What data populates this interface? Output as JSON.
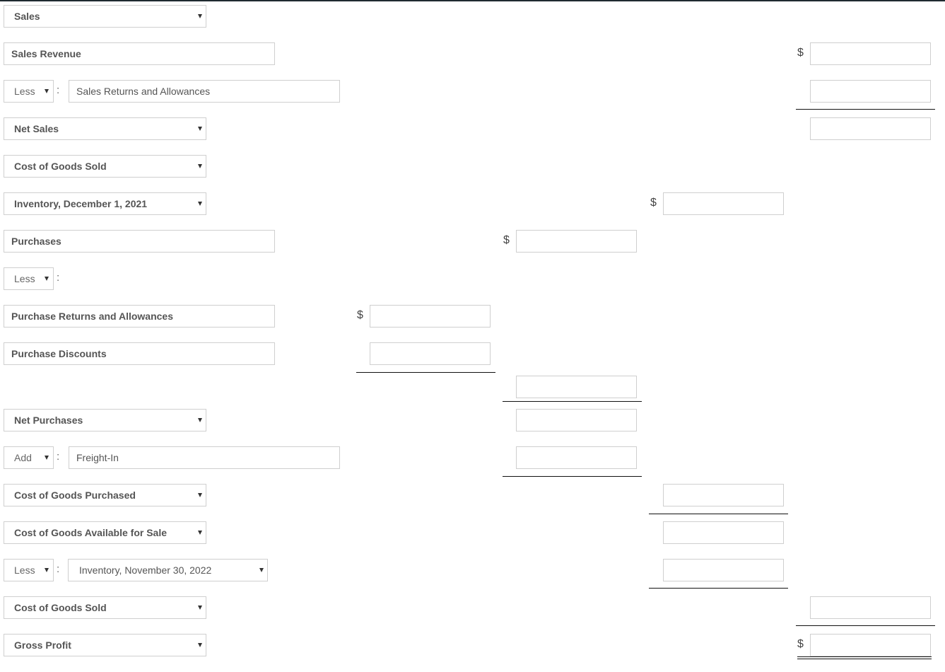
{
  "currency_symbol": "$",
  "colon": ":",
  "rows": [
    {
      "label": "Sales"
    },
    {
      "label": "Sales Revenue"
    },
    {
      "operator": "Less",
      "label": "Sales Returns and Allowances"
    },
    {
      "label": "Net Sales"
    },
    {
      "label": "Cost of Goods Sold"
    },
    {
      "label": "Inventory, December 1, 2021"
    },
    {
      "label": "Purchases"
    },
    {
      "operator": "Less"
    },
    {
      "label": "Purchase Returns and Allowances"
    },
    {
      "label": "Purchase Discounts"
    },
    {
      "label": ""
    },
    {
      "label": "Net Purchases"
    },
    {
      "operator": "Add",
      "label": "Freight-In"
    },
    {
      "label": "Cost of Goods Purchased"
    },
    {
      "label": "Cost of Goods Available for Sale"
    },
    {
      "operator": "Less",
      "label": "Inventory, November 30, 2022"
    },
    {
      "label": "Cost of Goods Sold"
    },
    {
      "label": "Gross Profit"
    }
  ],
  "amounts": {
    "sales_revenue": "",
    "sales_returns": "",
    "net_sales": "",
    "inventory_dec1": "",
    "purchases": "",
    "purchase_returns": "",
    "purchase_discounts": "",
    "total_deductions": "",
    "net_purchases": "",
    "freight_in": "",
    "cost_goods_purchased": "",
    "cost_goods_available": "",
    "inventory_nov30": "",
    "cost_goods_sold": "",
    "gross_profit": ""
  }
}
